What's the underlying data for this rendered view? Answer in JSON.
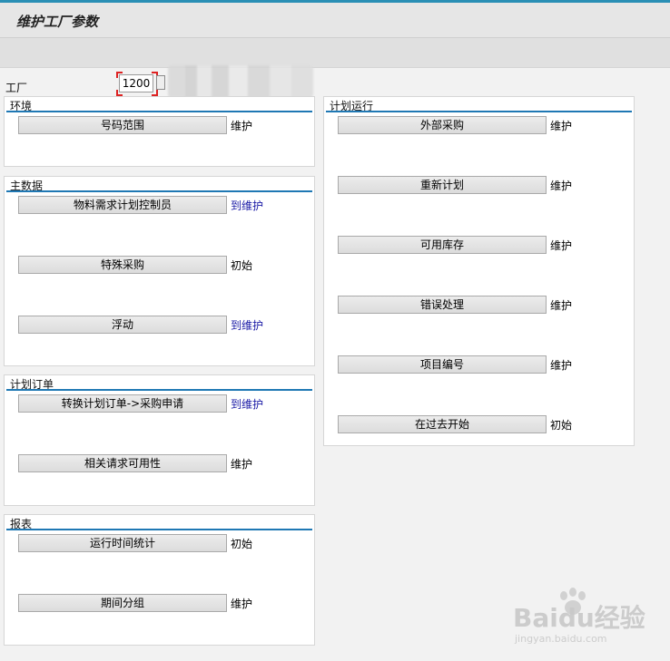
{
  "app": {
    "title": "维护工厂参数"
  },
  "plant": {
    "label": "工厂",
    "value": "1200"
  },
  "groups": {
    "environment": {
      "title": "环境",
      "rows": [
        {
          "button": "号码范围",
          "status": "维护"
        }
      ]
    },
    "master_data": {
      "title": "主数据",
      "rows": [
        {
          "button": "物料需求计划控制员",
          "status": "到维护"
        },
        {
          "button": "特殊采购",
          "status": "初始"
        },
        {
          "button": "浮动",
          "status": "到维护"
        }
      ]
    },
    "planned_order": {
      "title": "计划订单",
      "rows": [
        {
          "button": "转换计划订单->采购申请",
          "status": "到维护"
        },
        {
          "button": "相关请求可用性",
          "status": "维护"
        }
      ]
    },
    "reports": {
      "title": "报表",
      "rows": [
        {
          "button": "运行时间统计",
          "status": "初始"
        },
        {
          "button": "期间分组",
          "status": "维护"
        }
      ]
    },
    "planning_run": {
      "title": "计划运行",
      "rows": [
        {
          "button": "外部采购",
          "status": "维护"
        },
        {
          "button": "重新计划",
          "status": "维护"
        },
        {
          "button": "可用库存",
          "status": "维护"
        },
        {
          "button": "错误处理",
          "status": "维护"
        },
        {
          "button": "项目编号",
          "status": "维护"
        },
        {
          "button": "在过去开始",
          "status": "初始"
        }
      ]
    }
  },
  "watermark": {
    "brand": "Baidu经验",
    "url": "jingyan.baidu.com"
  },
  "colors": {
    "accent": "#1f78b4",
    "link": "#1a1aa6",
    "background": "#f2f2f2"
  }
}
